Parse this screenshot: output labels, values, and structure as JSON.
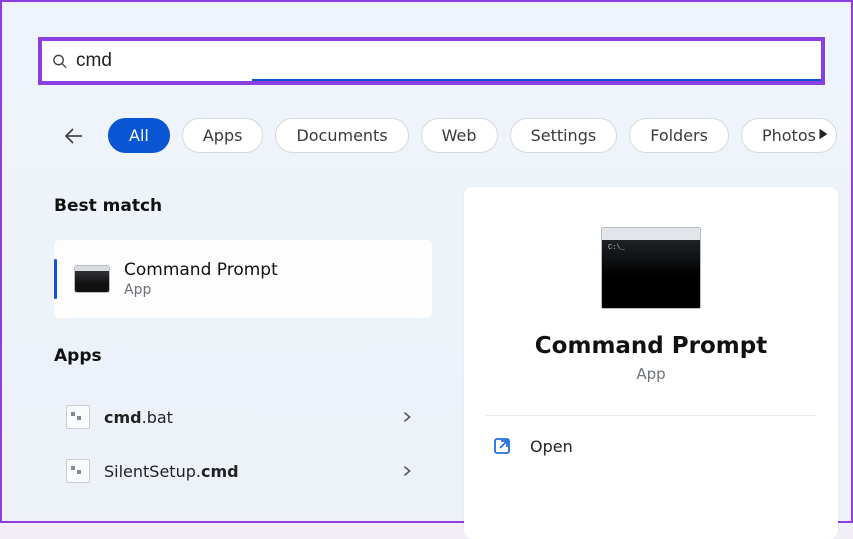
{
  "search": {
    "query": "cmd"
  },
  "filters": {
    "items": [
      {
        "label": "All",
        "active": true
      },
      {
        "label": "Apps",
        "active": false
      },
      {
        "label": "Documents",
        "active": false
      },
      {
        "label": "Web",
        "active": false
      },
      {
        "label": "Settings",
        "active": false
      },
      {
        "label": "Folders",
        "active": false
      },
      {
        "label": "Photos",
        "active": false
      }
    ]
  },
  "left": {
    "best_match_heading": "Best match",
    "best": {
      "title": "Command Prompt",
      "subtitle": "App"
    },
    "apps_heading": "Apps",
    "apps": [
      {
        "prefix": "cmd",
        "suffix": ".bat"
      },
      {
        "prefix": "SilentSetup.",
        "suffix": "cmd",
        "bold_suffix": true
      }
    ]
  },
  "preview": {
    "title": "Command Prompt",
    "subtitle": "App",
    "actions": [
      {
        "label": "Open",
        "icon": "open"
      }
    ]
  }
}
